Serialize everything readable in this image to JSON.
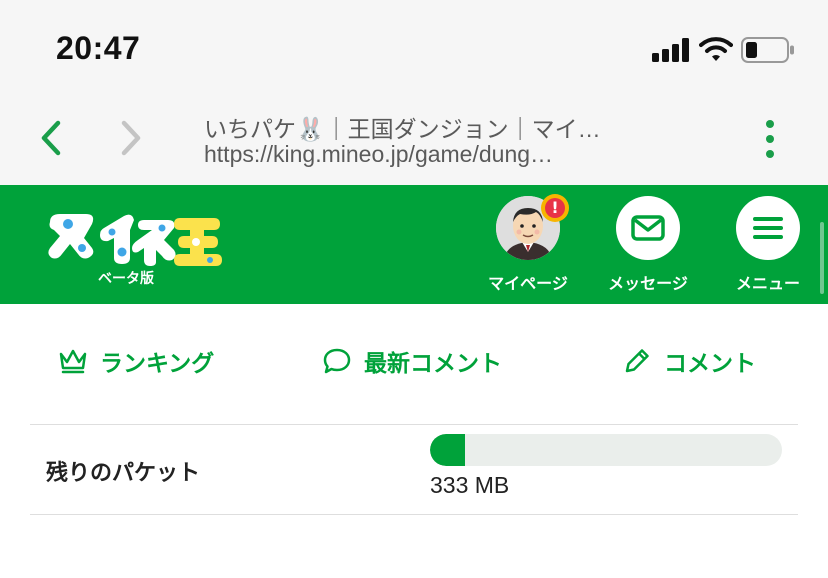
{
  "status_bar": {
    "time": "20:47",
    "signal_icon": "cellular-signal-icon",
    "wifi_icon": "wifi-icon",
    "battery_icon": "battery-icon",
    "battery_level": 0.3
  },
  "browser": {
    "back_icon": "chevron-left-icon",
    "forward_icon": "chevron-right-icon",
    "page_title": "いちパケ🐰｜王国ダンジョン｜マイ…",
    "url": "https://king.mineo.jp/game/dung…",
    "menu_icon": "kebab-menu-icon",
    "accent_color": "#1a9e4a"
  },
  "header": {
    "brand_color": "#00a23a",
    "logo_text": "マイネ王",
    "logo_subtitle": "ベータ版",
    "buttons": [
      {
        "label": "マイページ",
        "icon": "avatar-icon",
        "badge": "!"
      },
      {
        "label": "メッセージ",
        "icon": "envelope-icon"
      },
      {
        "label": "メニュー",
        "icon": "hamburger-menu-icon"
      }
    ]
  },
  "nav": {
    "items": [
      {
        "label": "ランキング",
        "icon": "crown-icon"
      },
      {
        "label": "最新コメント",
        "icon": "speech-bubble-icon"
      },
      {
        "label": "コメント",
        "icon": "pencil-icon"
      }
    ]
  },
  "packet": {
    "label": "残りのパケット",
    "value": "333 MB",
    "progress": 0.1
  }
}
